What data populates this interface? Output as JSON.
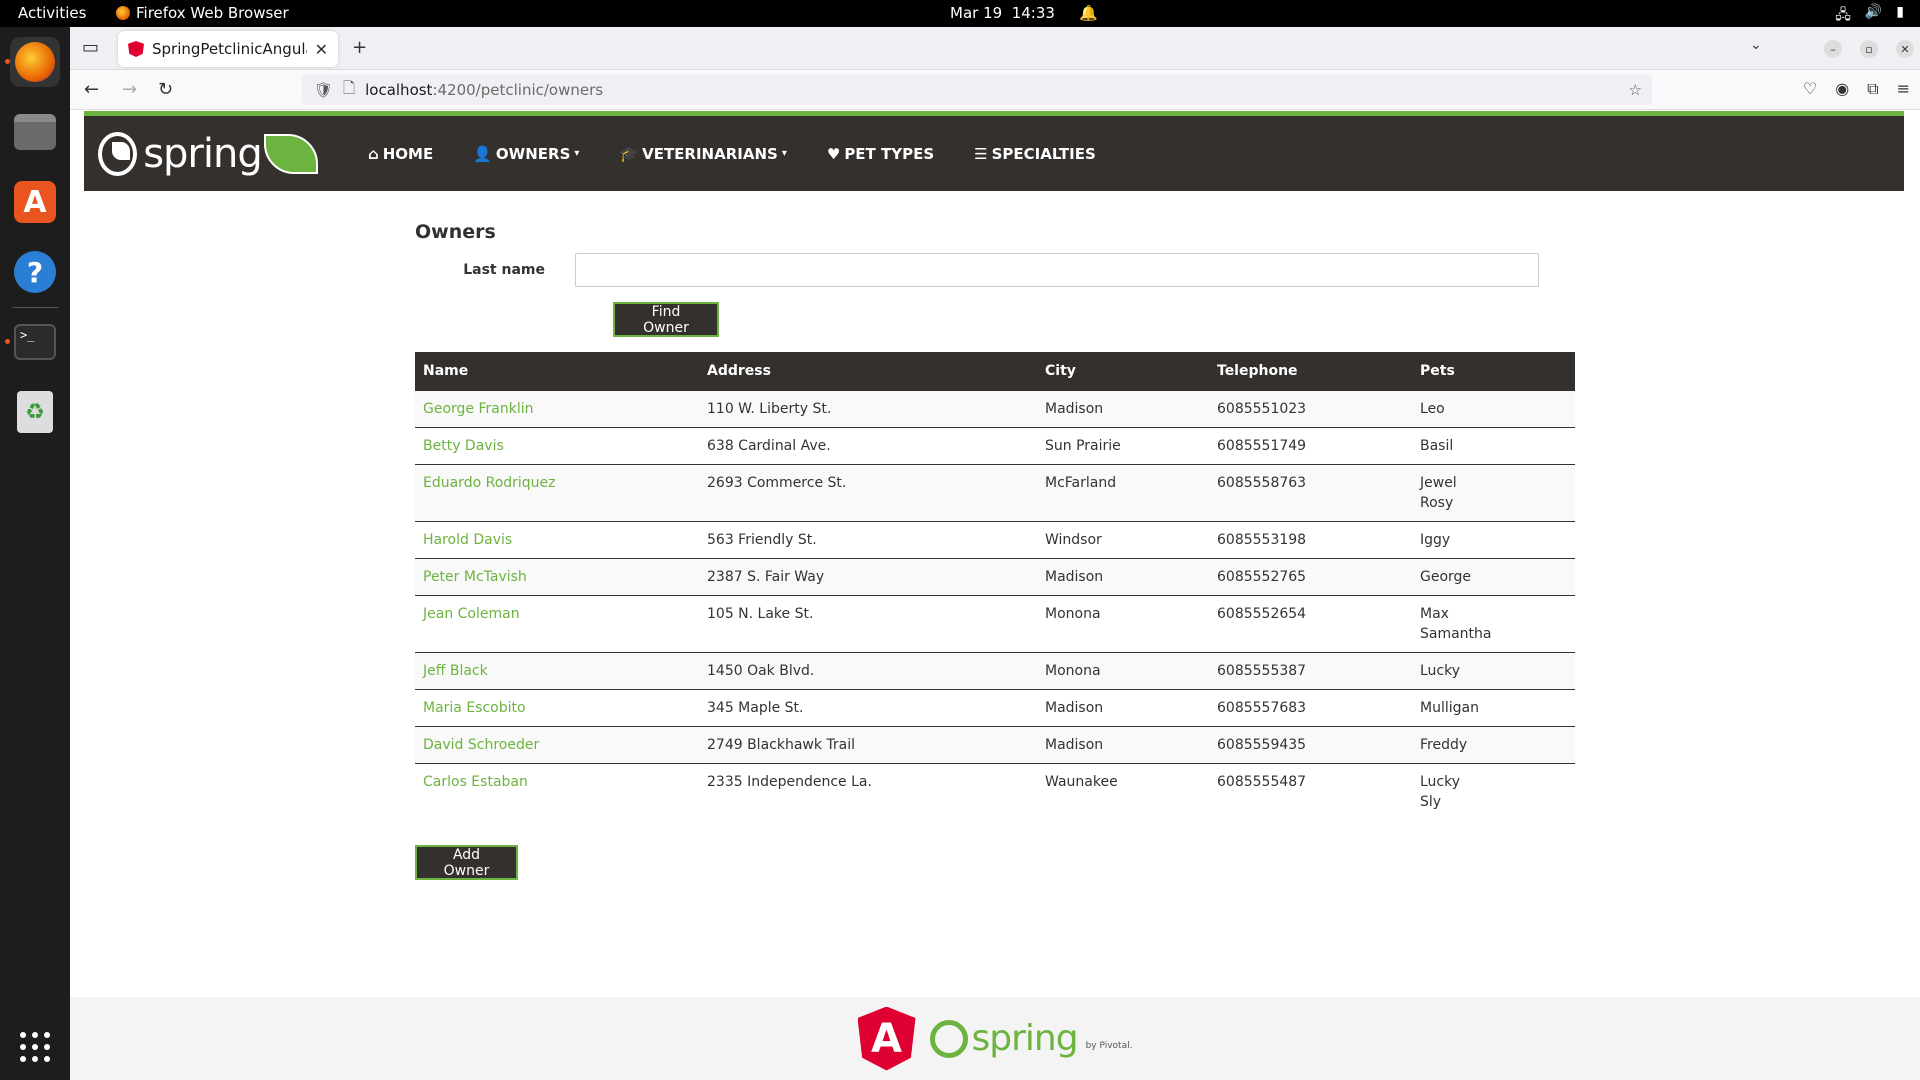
{
  "topbar": {
    "activities": "Activities",
    "app_name": "Firefox Web Browser",
    "date": "Mar 19",
    "time": "14:33"
  },
  "browser": {
    "tab_title": "SpringPetclinicAngular",
    "url_host": "localhost",
    "url_path": ":4200/petclinic/owners"
  },
  "nav": {
    "brand": "spring",
    "home": "HOME",
    "owners": "OWNERS",
    "veterinarians": "VETERINARIANS",
    "pet_types": "PET TYPES",
    "specialties": "SPECIALTIES"
  },
  "owners_page": {
    "title": "Owners",
    "last_name_label": "Last name",
    "last_name_value": "",
    "find_button": "Find Owner",
    "add_button": "Add Owner",
    "columns": [
      "Name",
      "Address",
      "City",
      "Telephone",
      "Pets"
    ],
    "rows": [
      {
        "name": "George Franklin",
        "address": "110 W. Liberty St.",
        "city": "Madison",
        "telephone": "6085551023",
        "pets": [
          "Leo"
        ]
      },
      {
        "name": "Betty Davis",
        "address": "638 Cardinal Ave.",
        "city": "Sun Prairie",
        "telephone": "6085551749",
        "pets": [
          "Basil"
        ]
      },
      {
        "name": "Eduardo Rodriquez",
        "address": "2693 Commerce St.",
        "city": "McFarland",
        "telephone": "6085558763",
        "pets": [
          "Jewel",
          "Rosy"
        ]
      },
      {
        "name": "Harold Davis",
        "address": "563 Friendly St.",
        "city": "Windsor",
        "telephone": "6085553198",
        "pets": [
          "Iggy"
        ]
      },
      {
        "name": "Peter McTavish",
        "address": "2387 S. Fair Way",
        "city": "Madison",
        "telephone": "6085552765",
        "pets": [
          "George"
        ]
      },
      {
        "name": "Jean Coleman",
        "address": "105 N. Lake St.",
        "city": "Monona",
        "telephone": "6085552654",
        "pets": [
          "Max",
          "Samantha"
        ]
      },
      {
        "name": "Jeff Black",
        "address": "1450 Oak Blvd.",
        "city": "Monona",
        "telephone": "6085555387",
        "pets": [
          "Lucky"
        ]
      },
      {
        "name": "Maria Escobito",
        "address": "345 Maple St.",
        "city": "Madison",
        "telephone": "6085557683",
        "pets": [
          "Mulligan"
        ]
      },
      {
        "name": "David Schroeder",
        "address": "2749 Blackhawk Trail",
        "city": "Madison",
        "telephone": "6085559435",
        "pets": [
          "Freddy"
        ]
      },
      {
        "name": "Carlos Estaban",
        "address": "2335 Independence La.",
        "city": "Waunakee",
        "telephone": "6085555487",
        "pets": [
          "Lucky",
          "Sly"
        ]
      }
    ]
  },
  "footer": {
    "angular_letter": "A",
    "spring_word": "spring",
    "by_pivotal": "by Pivotal."
  },
  "colors": {
    "spring_green": "#6db33f",
    "nav_dark": "#34302d",
    "angular_red": "#dd0031"
  }
}
